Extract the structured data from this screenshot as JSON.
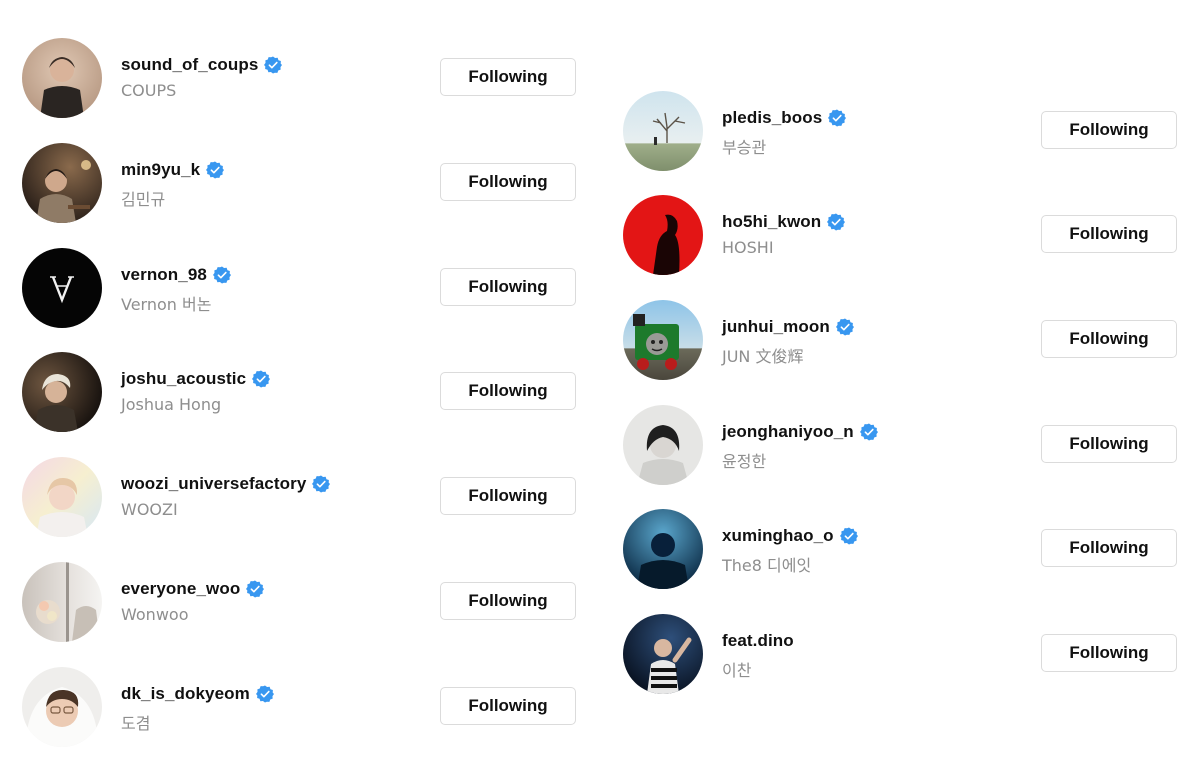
{
  "left_column": [
    {
      "username": "sound_of_coups",
      "full_name": "COUPS",
      "button": "Following",
      "verified": true
    },
    {
      "username": "min9yu_k",
      "full_name": "김민규",
      "button": "Following",
      "verified": true
    },
    {
      "username": "vernon_98",
      "full_name": "Vernon 버논",
      "button": "Following",
      "verified": true
    },
    {
      "username": "joshu_acoustic",
      "full_name": "Joshua Hong",
      "button": "Following",
      "verified": true
    },
    {
      "username": "woozi_universefactory",
      "full_name": "WOOZI",
      "button": "Following",
      "verified": true
    },
    {
      "username": "everyone_woo",
      "full_name": "Wonwoo",
      "button": "Following",
      "verified": true
    },
    {
      "username": "dk_is_dokyeom",
      "full_name": "도겸",
      "button": "Following",
      "verified": true
    }
  ],
  "right_column": [
    {
      "username": "pledis_boos",
      "full_name": "부승관",
      "button": "Following",
      "verified": true
    },
    {
      "username": "ho5hi_kwon",
      "full_name": "HOSHI",
      "button": "Following",
      "verified": true
    },
    {
      "username": "junhui_moon",
      "full_name": "JUN 文俊辉",
      "button": "Following",
      "verified": true
    },
    {
      "username": "jeonghaniyoo_n",
      "full_name": "윤정한",
      "button": "Following",
      "verified": true
    },
    {
      "username": "xuminghao_o",
      "full_name": "The8 디에잇",
      "button": "Following",
      "verified": true
    },
    {
      "username": "feat.dino",
      "full_name": "이찬",
      "button": "Following",
      "verified": true
    }
  ],
  "avatar_logo_text": "V",
  "colors": {
    "verified_badge": "#3897f0",
    "secondary_text": "#8e8e8e",
    "button_border": "#dbdbdb"
  }
}
